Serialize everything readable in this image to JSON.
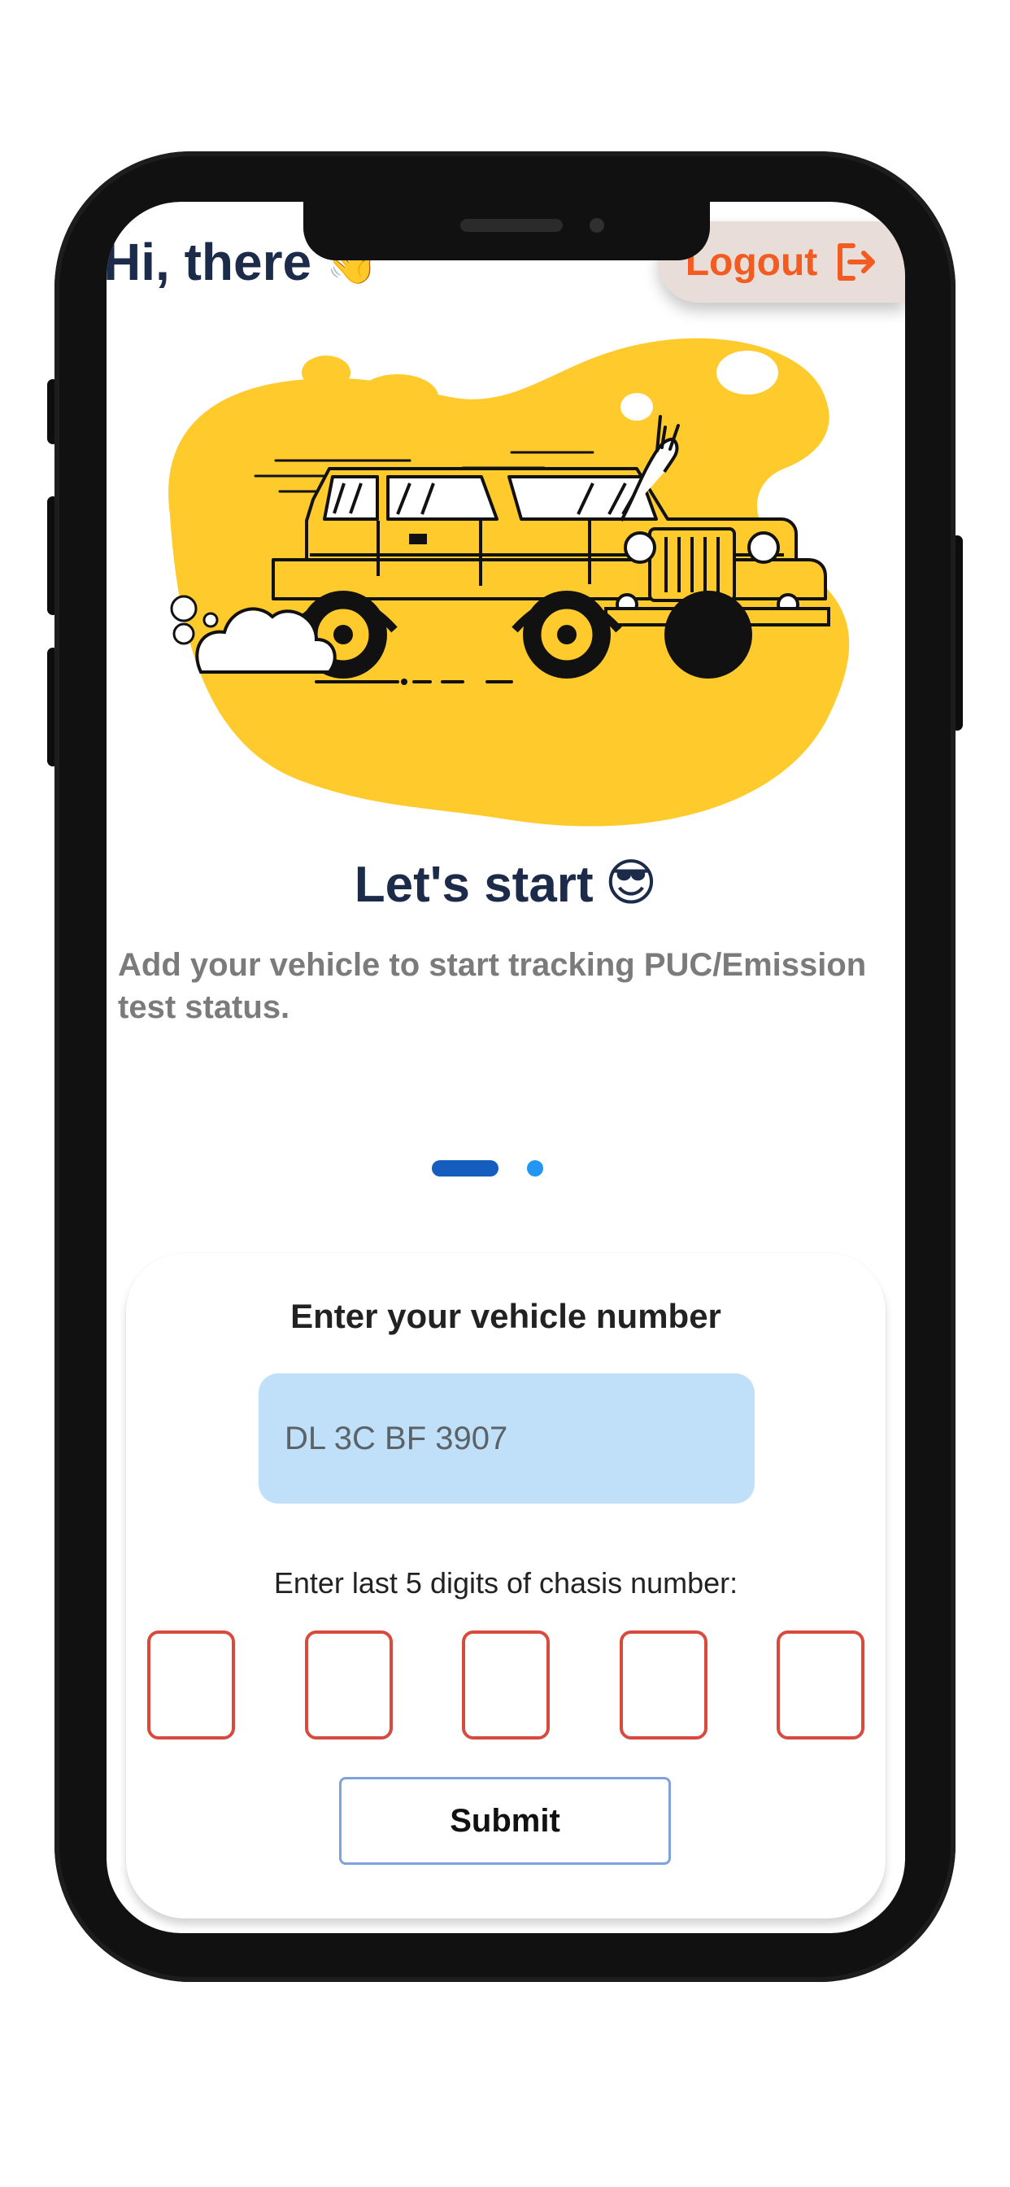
{
  "header": {
    "greeting": "Hi, there",
    "greeting_emoji": "👋",
    "logout_label": "Logout",
    "logout_icon": "logout-icon"
  },
  "onboarding": {
    "title": "Let's start",
    "title_emoji": "😎",
    "subtitle": "Add your vehicle to start tracking PUC/Emission test status.",
    "active_slide": 1,
    "slide_count": 2,
    "illustration": "jeep-illustration"
  },
  "form": {
    "vehicle_number_label": "Enter your vehicle number",
    "vehicle_number_placeholder": "DL 3C BF 3907",
    "chassis_label": "Enter last 5 digits of chasis number:",
    "chassis_digits": [
      "",
      "",
      "",
      "",
      ""
    ],
    "submit_label": "Submit"
  },
  "colors": {
    "primary_text": "#1b2b49",
    "logout_text": "#f25c21",
    "logout_background": "#e9ddda",
    "illustration_yellow": "#ffca2c",
    "active_dot": "#155ec0",
    "inactive_dot": "#2296f3",
    "input_background": "#bfe0f8",
    "digit_border": "#d84a3d",
    "submit_border": "#7fa2dd"
  }
}
